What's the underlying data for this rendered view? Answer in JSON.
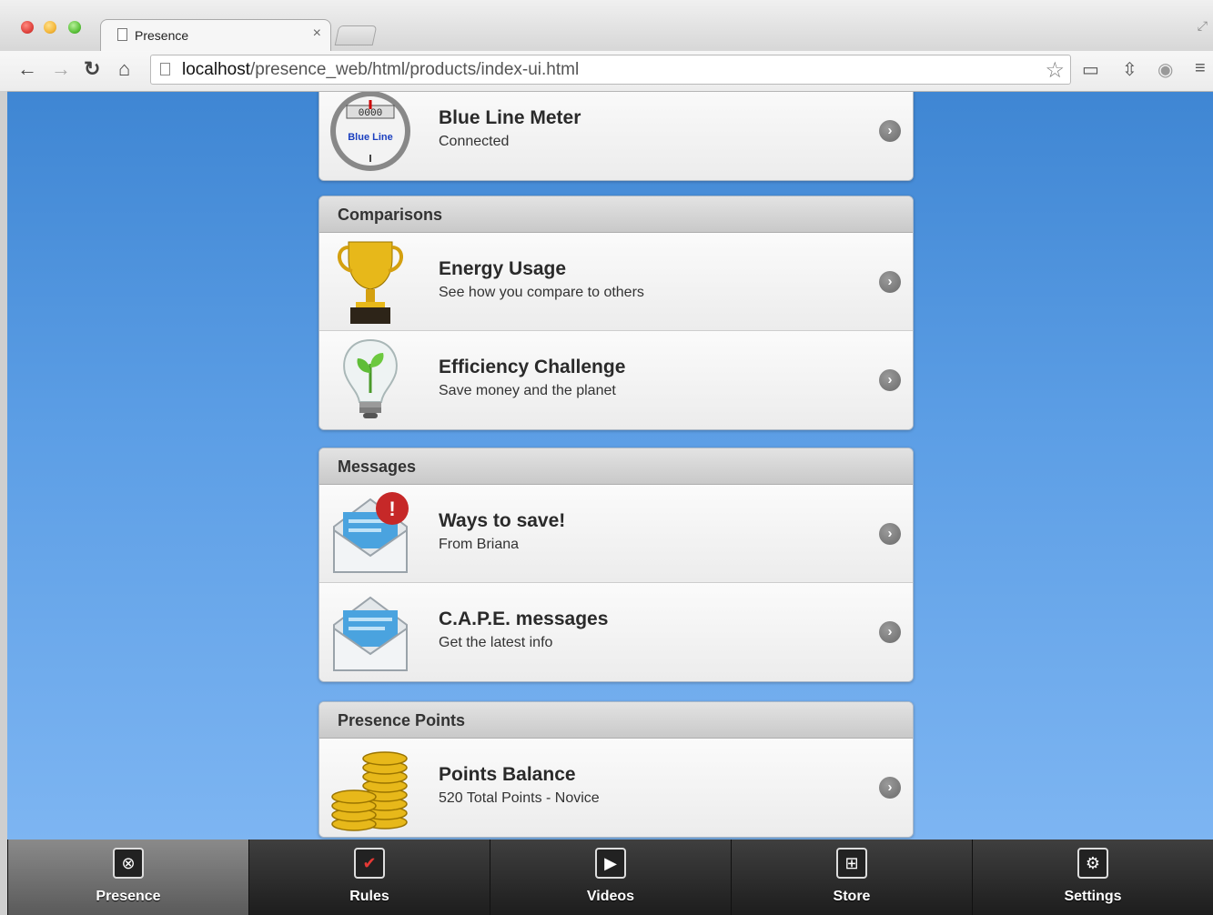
{
  "browser": {
    "tab_title": "Presence",
    "tab_close": "×",
    "url_host": "localhost",
    "url_path": "/presence_web/html/products/index-ui.html"
  },
  "sections": {
    "meter": {
      "rows": [
        {
          "title": "Blue Line Meter",
          "subtitle": "Connected",
          "icon_label": "Blue Line",
          "icon_digits": "0000"
        }
      ]
    },
    "comparisons": {
      "header": "Comparisons",
      "rows": [
        {
          "title": "Energy Usage",
          "subtitle": "See how you compare to others"
        },
        {
          "title": "Efficiency Challenge",
          "subtitle": "Save money and the planet"
        }
      ]
    },
    "messages": {
      "header": "Messages",
      "rows": [
        {
          "title": "Ways to save!",
          "subtitle": "From Briana",
          "badge": "!"
        },
        {
          "title": "C.A.P.E. messages",
          "subtitle": "Get the latest info"
        }
      ]
    },
    "points": {
      "header": "Presence Points",
      "rows": [
        {
          "title": "Points Balance",
          "subtitle": "520 Total Points - Novice"
        }
      ]
    }
  },
  "tabbar": {
    "items": [
      {
        "label": "Presence",
        "icon": "presence-icon",
        "active": true
      },
      {
        "label": "Rules",
        "icon": "checkmark-icon"
      },
      {
        "label": "Videos",
        "icon": "play-icon"
      },
      {
        "label": "Store",
        "icon": "cart-icon"
      },
      {
        "label": "Settings",
        "icon": "gears-icon"
      }
    ]
  },
  "colors": {
    "background_top": "#3f86d3",
    "background_bottom": "#7db5f2",
    "tabbar": "#2a2a2a"
  }
}
